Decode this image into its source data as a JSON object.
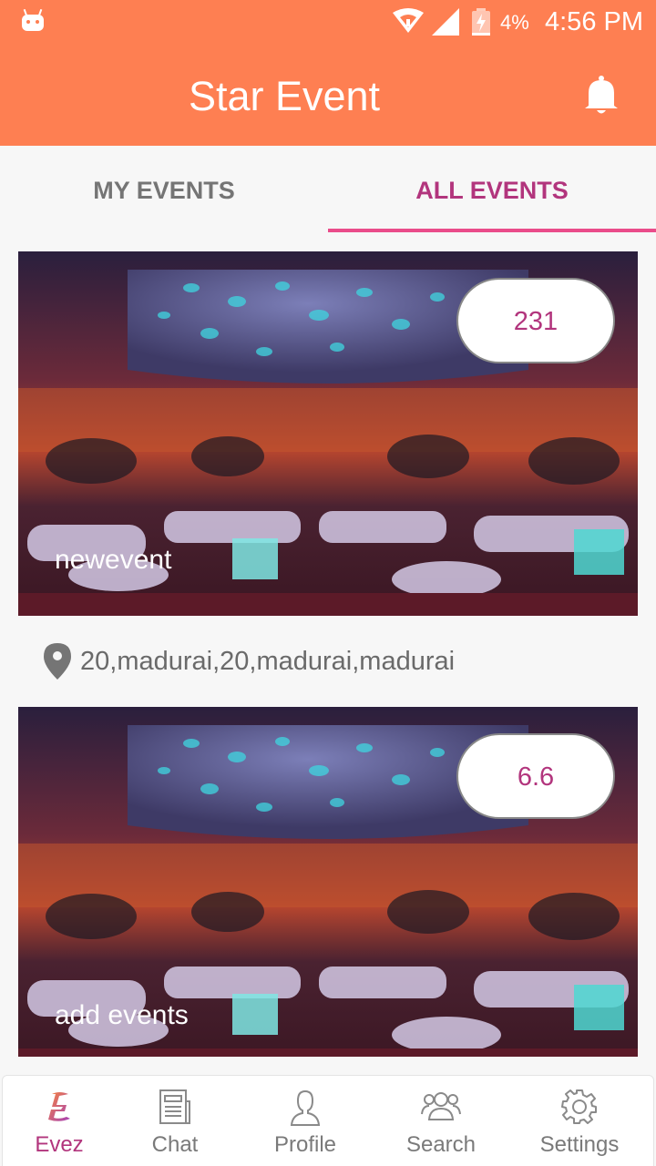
{
  "status_bar": {
    "battery": "4%",
    "time": "4:56 PM"
  },
  "app_bar": {
    "title": "Star Event"
  },
  "tabs": [
    {
      "label": "MY EVENTS",
      "active": false
    },
    {
      "label": "ALL EVENTS",
      "active": true
    }
  ],
  "events": [
    {
      "name": "newevent",
      "count": "231",
      "location": "20,madurai,20,madurai,madurai"
    },
    {
      "name": "add events",
      "count": "6.6"
    }
  ],
  "bottom_nav": [
    {
      "label": "Evez",
      "icon": "evez-logo-icon",
      "active": true
    },
    {
      "label": "Chat",
      "icon": "newspaper-icon",
      "active": false
    },
    {
      "label": "Profile",
      "icon": "person-icon",
      "active": false
    },
    {
      "label": "Search",
      "icon": "group-icon",
      "active": false
    },
    {
      "label": "Settings",
      "icon": "gear-icon",
      "active": false
    }
  ],
  "colors": {
    "primary": "#fe7f52",
    "accent": "#b2357d",
    "indicator": "#ea4c8a"
  }
}
